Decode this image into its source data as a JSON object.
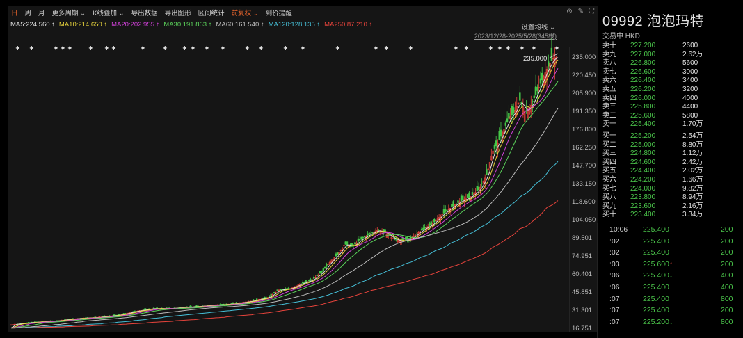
{
  "toolbar": {
    "items": [
      "日",
      "周",
      "月",
      "更多周期 ⌄",
      "K线叠加 ⌄",
      "导出数据",
      "导出图形",
      "区间统计",
      "前复权 ⌄",
      "到价提醒"
    ],
    "active_index": 0,
    "accent_index": 8
  },
  "ma_row": [
    {
      "text": "MA5:224.560 ↑",
      "color": "#e0e0e0"
    },
    {
      "text": "MA10:214.650 ↑",
      "color": "#e6d23c"
    },
    {
      "text": "MA20:202.955 ↑",
      "color": "#d040d8"
    },
    {
      "text": "MA30:191.863 ↑",
      "color": "#5bd25b"
    },
    {
      "text": "MA60:161.540 ↑",
      "color": "#bcbcbc"
    },
    {
      "text": "MA120:128.135 ↑",
      "color": "#46c0d8"
    },
    {
      "text": "MA250:87.210 ↑",
      "color": "#e8443c"
    }
  ],
  "settings_label": "设置均线 ⌄",
  "date_range": "2023/12/28-2025/5/28(345根)",
  "y_axis_labels": [
    "235.000",
    "220.450",
    "205.900",
    "191.350",
    "176.800",
    "162.250",
    "147.700",
    "133.150",
    "118.600",
    "104.050",
    "89.501",
    "74.951",
    "60.401",
    "45.851",
    "31.301",
    "16.751"
  ],
  "price_marker": "235.000",
  "stock": {
    "title": "09992 泡泡玛特",
    "status": "交易中 HKD"
  },
  "order_book": {
    "asks": [
      {
        "label": "卖十",
        "price": "227.200",
        "vol": "2600"
      },
      {
        "label": "卖九",
        "price": "227.000",
        "vol": "2.62万"
      },
      {
        "label": "卖八",
        "price": "226.800",
        "vol": "5600"
      },
      {
        "label": "卖七",
        "price": "226.600",
        "vol": "3000"
      },
      {
        "label": "卖六",
        "price": "226.400",
        "vol": "3400"
      },
      {
        "label": "卖五",
        "price": "226.200",
        "vol": "3200"
      },
      {
        "label": "卖四",
        "price": "226.000",
        "vol": "4000"
      },
      {
        "label": "卖三",
        "price": "225.800",
        "vol": "4400"
      },
      {
        "label": "卖二",
        "price": "225.600",
        "vol": "5800"
      },
      {
        "label": "卖一",
        "price": "225.400",
        "vol": "1.70万"
      }
    ],
    "bids": [
      {
        "label": "买一",
        "price": "225.200",
        "vol": "2.54万"
      },
      {
        "label": "买二",
        "price": "225.000",
        "vol": "8.80万"
      },
      {
        "label": "买三",
        "price": "224.800",
        "vol": "1.12万"
      },
      {
        "label": "买四",
        "price": "224.600",
        "vol": "2.42万"
      },
      {
        "label": "买五",
        "price": "224.400",
        "vol": "2.02万"
      },
      {
        "label": "买六",
        "price": "224.200",
        "vol": "1.66万"
      },
      {
        "label": "买七",
        "price": "224.000",
        "vol": "9.82万"
      },
      {
        "label": "买八",
        "price": "223.800",
        "vol": "8.94万"
      },
      {
        "label": "买九",
        "price": "223.600",
        "vol": "2.16万"
      },
      {
        "label": "买十",
        "price": "223.400",
        "vol": "3.34万"
      }
    ]
  },
  "ticks": [
    {
      "time": "10:06",
      "price": "225.400",
      "arrow": "",
      "vol": "200"
    },
    {
      "time": ":02",
      "price": "225.400",
      "arrow": "",
      "vol": "200"
    },
    {
      "time": ":02",
      "price": "225.400",
      "arrow": "",
      "vol": "200"
    },
    {
      "time": ":03",
      "price": "225.600",
      "arrow": "up",
      "vol": "200"
    },
    {
      "time": ":06",
      "price": "225.400",
      "arrow": "down",
      "vol": "400"
    },
    {
      "time": ":06",
      "price": "225.400",
      "arrow": "",
      "vol": "400"
    },
    {
      "time": ":07",
      "price": "225.400",
      "arrow": "",
      "vol": "800"
    },
    {
      "time": ":07",
      "price": "225.400",
      "arrow": "",
      "vol": "200"
    },
    {
      "time": ":07",
      "price": "225.200",
      "arrow": "down",
      "vol": "800"
    }
  ],
  "chart_data": {
    "type": "candlestick",
    "y_range": [
      16.751,
      235.0
    ],
    "y_ticks": [
      235.0,
      220.45,
      205.9,
      191.35,
      176.8,
      162.25,
      147.7,
      133.15,
      118.6,
      104.05,
      89.501,
      74.951,
      60.401,
      45.851,
      31.301,
      16.751
    ],
    "n_bars": 345,
    "close_path": [
      [
        0,
        19
      ],
      [
        20,
        21
      ],
      [
        40,
        22
      ],
      [
        60,
        24
      ],
      [
        80,
        25
      ],
      [
        100,
        27
      ],
      [
        115,
        30
      ],
      [
        130,
        32
      ],
      [
        145,
        32
      ],
      [
        160,
        33
      ],
      [
        175,
        34
      ],
      [
        190,
        35
      ],
      [
        205,
        36
      ],
      [
        220,
        38
      ],
      [
        235,
        41
      ],
      [
        245,
        47
      ],
      [
        255,
        48
      ],
      [
        265,
        52
      ],
      [
        275,
        55
      ],
      [
        285,
        62
      ],
      [
        290,
        68
      ],
      [
        300,
        77
      ],
      [
        305,
        84
      ],
      [
        312,
        82
      ],
      [
        320,
        88
      ],
      [
        328,
        92
      ],
      [
        335,
        95
      ],
      [
        342,
        93
      ],
      [
        350,
        88
      ],
      [
        357,
        86
      ],
      [
        365,
        88
      ],
      [
        375,
        95
      ],
      [
        385,
        100
      ],
      [
        393,
        107
      ],
      [
        400,
        112
      ],
      [
        410,
        118
      ],
      [
        420,
        122
      ],
      [
        428,
        128
      ],
      [
        435,
        140
      ],
      [
        440,
        158
      ],
      [
        445,
        165
      ],
      [
        450,
        175
      ],
      [
        455,
        185
      ],
      [
        460,
        190
      ],
      [
        465,
        200
      ],
      [
        470,
        190
      ],
      [
        475,
        195
      ],
      [
        480,
        205
      ],
      [
        485,
        215
      ],
      [
        490,
        225
      ],
      [
        495,
        233
      ],
      [
        500,
        235
      ]
    ],
    "ma_series": [
      {
        "name": "MA5",
        "color": "#e0e0e0",
        "lag": 3
      },
      {
        "name": "MA10",
        "color": "#e6d23c",
        "lag": 6
      },
      {
        "name": "MA20",
        "color": "#d040d8",
        "lag": 12
      },
      {
        "name": "MA30",
        "color": "#5bd25b",
        "lag": 20
      },
      {
        "name": "MA60",
        "color": "#bcbcbc",
        "lag": 45
      },
      {
        "name": "MA120",
        "color": "#46c0d8",
        "lag": 95
      },
      {
        "name": "MA250",
        "color": "#e8443c",
        "lag": 170
      }
    ],
    "xlabel": "",
    "ylabel": ""
  }
}
